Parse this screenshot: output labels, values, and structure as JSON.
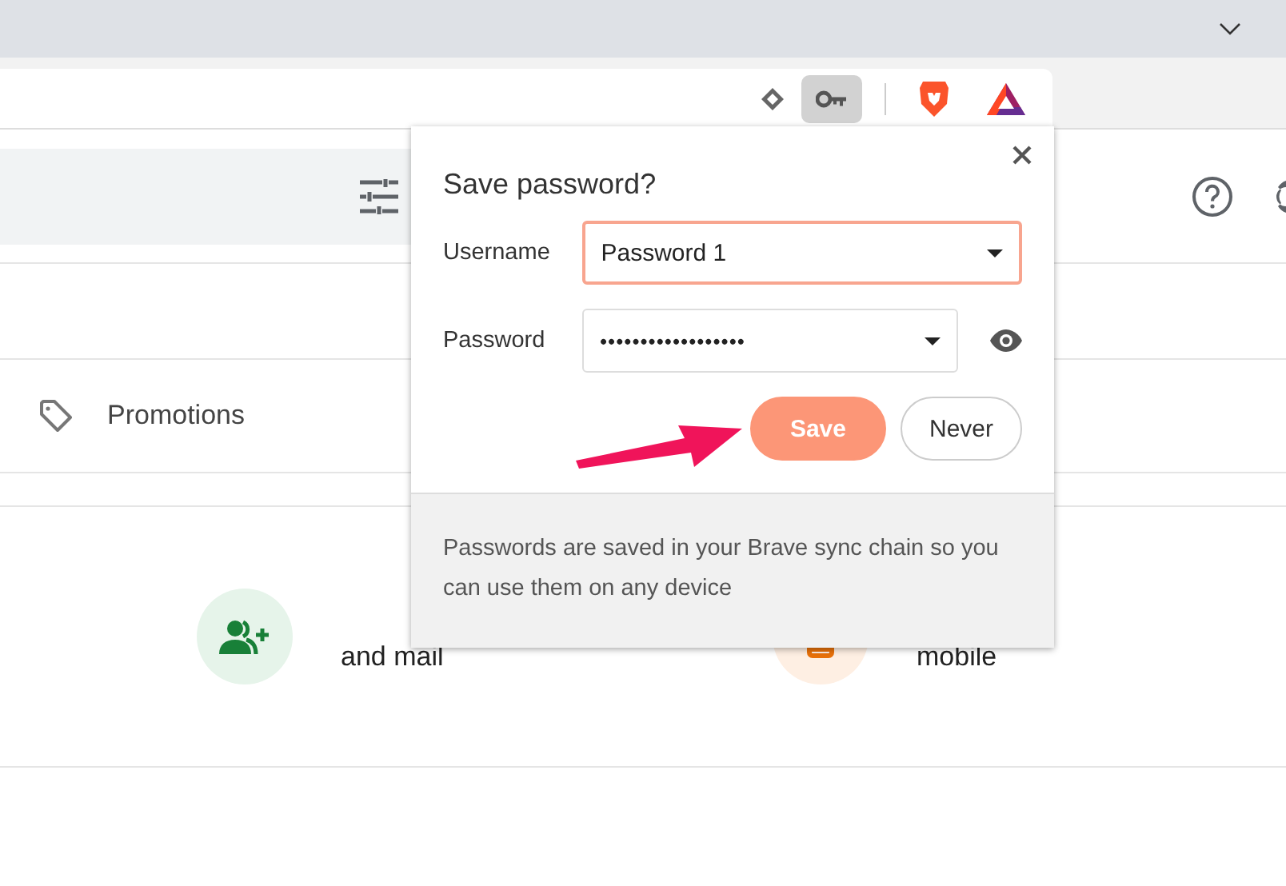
{
  "mail": {
    "tabs": [
      {
        "label": "Promotions"
      }
    ],
    "promos": [
      {
        "kind": "contacts",
        "text": "and mail"
      },
      {
        "kind": "mobile",
        "text": "mobile"
      }
    ]
  },
  "popup": {
    "title": "Save password?",
    "fields": [
      {
        "kind": "select",
        "label": "Username",
        "value": "Password 1",
        "focused": true
      },
      {
        "kind": "secret",
        "label": "Password",
        "value": "••••••••••••••••••",
        "focused": false
      }
    ],
    "buttons": [
      {
        "label": "Save",
        "primary": true
      },
      {
        "label": "Never",
        "primary": false
      }
    ],
    "footer": "Passwords are saved in your Brave sync chain so you can use them on any device"
  }
}
